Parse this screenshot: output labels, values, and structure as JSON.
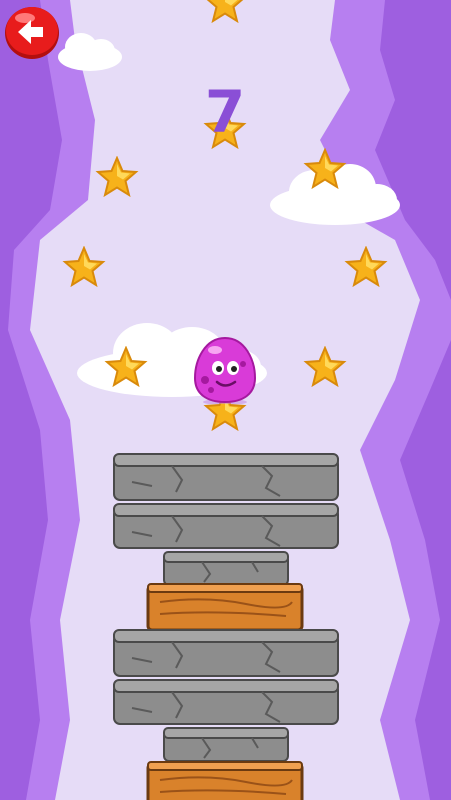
{
  "game": {
    "score": "7",
    "back_button_icon": "back-arrow-icon",
    "player_icon": "pink-blob-character-icon",
    "collectible_icon": "star-icon",
    "colors": {
      "background": "#e6dcf7",
      "wall": "#b77ff0",
      "score": "#8a4fd6",
      "star": "#f7b21a",
      "player": "#d93bd8",
      "back_button": "#e81c1c"
    },
    "stars_total_visible": 10,
    "stone_blocks_visible": 6,
    "wood_blocks_visible": 2
  }
}
